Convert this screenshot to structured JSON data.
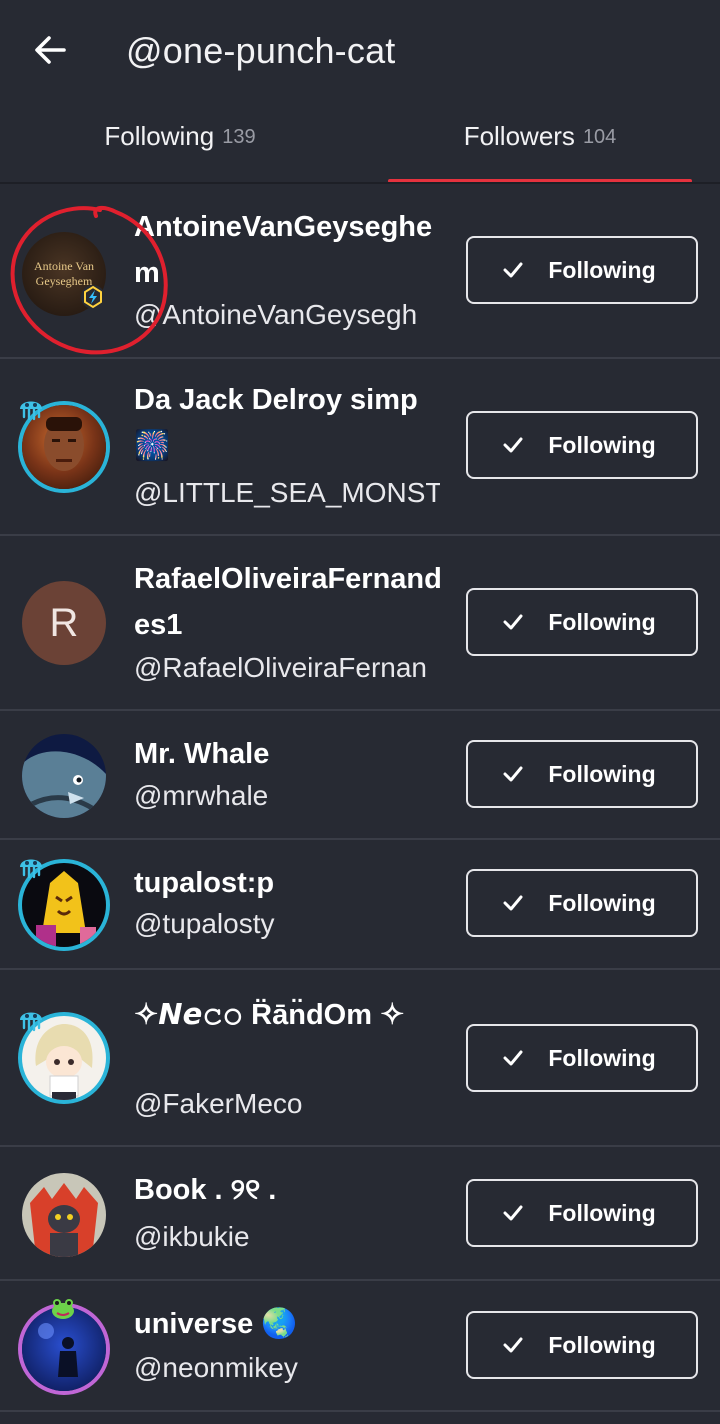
{
  "header": {
    "title": "@one-punch-cat"
  },
  "tabs": {
    "following_label": "Following",
    "following_count": "139",
    "followers_label": "Followers",
    "followers_count": "104"
  },
  "follow_button_label": "Following",
  "users": [
    {
      "name": "AntoineVanGeysegh­hem",
      "name_display": "AntoineVanGeyseghem",
      "handle": "@AntoineVanGeysegh",
      "avatar_text": "Antoine Van Geyseghem"
    },
    {
      "name": "Da Jack Delroy simp 🎆",
      "handle": "@LITTLE_SEA_MONST"
    },
    {
      "name": "RafaelOliveiraFernandes1",
      "handle": "@RafaelOliveiraFernan",
      "avatar_letter": "R"
    },
    {
      "name": "Mr. Whale",
      "handle": "@mrwhale"
    },
    {
      "name": "tupalost:p",
      "handle": "@tupalosty"
    },
    {
      "name": "✧𝙉𝙚𝚌𝚘 R̈ān̈dOm ✧",
      "handle": "@FakerMeco"
    },
    {
      "name": "Book . ୨୧ .",
      "handle": "@ikbukie"
    },
    {
      "name": "universe 🌏",
      "handle": "@neonmikey"
    }
  ],
  "colors": {
    "background": "#272a33",
    "accent": "#e5323e",
    "divider": "#3a3d47",
    "ring_blue": "#2ab4d8"
  }
}
